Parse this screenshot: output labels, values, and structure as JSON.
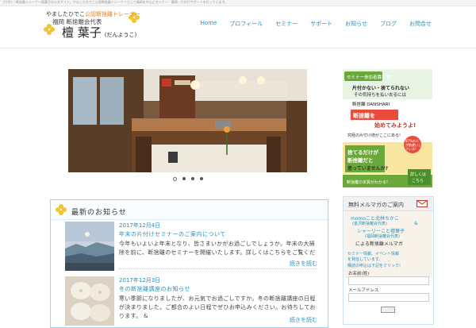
{
  "topbar": {
    "text": "片付け・断捨離トレーナー檀葉子の公式サイト。やましたひでこ公認断捨離トレーナーとして福岡を中心にセミナー・講演・片付けサポートを行っています。"
  },
  "header": {
    "tagline_prefix": "やましたひでこ",
    "tagline_highlight": "公認断捨離トレーナー",
    "org": "福岡 断捨離会代表",
    "name": "檀 葉子",
    "name_kana": "(だんようこ)"
  },
  "nav": [
    "Home",
    "プロフィール",
    "セミナー",
    "サポート",
    "お知らせ",
    "ブログ",
    "お問合せ"
  ],
  "slider": {
    "dots": 4,
    "active_index": 0
  },
  "news": {
    "title": "最新のお知らせ",
    "posts": [
      {
        "date": "2017年12月4日",
        "title": "年末の片付けセミナーのご案内について",
        "excerpt": "今年もいよいよ年末となり、皆さまいかがお過ごしでしょうか。年末の大掃除を前に、断捨離のセミナーを開催いたします。詳しくはこちらをご覧ください。皆さまのご参加を心よりお待ちしております。",
        "more": "続きを読む"
      },
      {
        "date": "2017年12月3日",
        "title": "冬の断捨離講座のお知らせ",
        "excerpt": "寒い季節になりましたが、お元気でお過ごしですか。冬の断捨離講座の日程が決まりました。ご都合のよい日程でぜひお申込みください。お待ちしております。 &",
        "more": "続きを読む"
      }
    ]
  },
  "ad": {
    "badge": "セミナー参加者募集中!",
    "line1": "片付かない・捨てられない",
    "line2": "その気持ちを払い去るには",
    "headline1": "断捨離を",
    "headline2": "始めてみようよ!",
    "logo": "断捨離 DANSHARI",
    "sub": "究極の片付け術がここにある!",
    "q1": "捨てるだけが",
    "q2": "断捨離だと",
    "q3": "思っていませんか?",
    "stat": "87%の人が勘違いしている!",
    "foot": "断捨離の本質がわかる!",
    "cta1": "詳しくは",
    "cta2": "こちら"
  },
  "magazine": {
    "title": "無料メルマガのご案内",
    "l1": "momoこと北林ちかこ",
    "l2": "(金沢断捨離会代表)",
    "amp": "&",
    "l3": "シャーリーこと檀葉子",
    "l4": "(福岡断捨離会代表)",
    "l5": "による断捨離メルマガ",
    "l6": "セミナー情報、イベント情報",
    "l7": "を発信しています。",
    "l8": "購読の申込は下記をクリック!",
    "label_name": "お名前(姓)",
    "label_email": "メールアドレス"
  },
  "colors": {
    "accent": "#2a8fbd",
    "clover": "#f4c331",
    "green": "#6aa83a",
    "orange": "#e67e22"
  }
}
